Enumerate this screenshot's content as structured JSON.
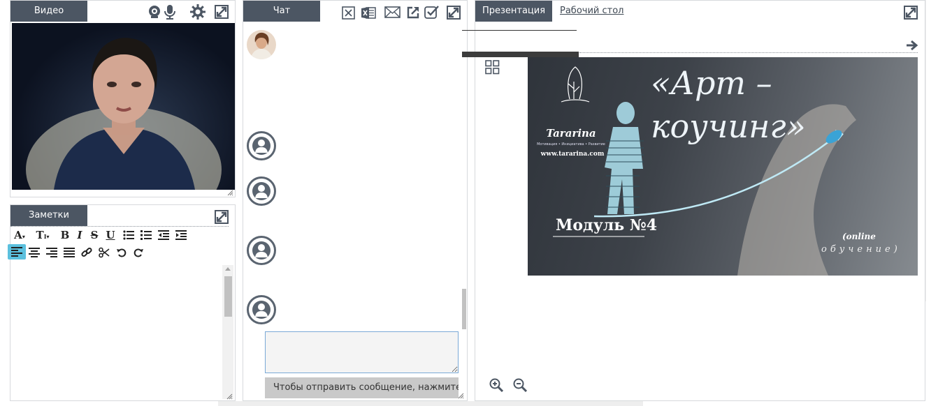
{
  "video": {
    "tab_label": "Видео",
    "icons": [
      "webcam-icon",
      "microphone-icon",
      "gear-icon",
      "expand-icon"
    ]
  },
  "notes": {
    "tab_label": "Заметки",
    "toolbar": {
      "font_size": "A",
      "font_family": "T",
      "bold": "B",
      "italic": "I",
      "strike": "S",
      "underline": "U"
    }
  },
  "chat": {
    "tab_label": "Чат",
    "send_hint": "Чтобы отправить сообщение, нажмите Enter",
    "input_value": ""
  },
  "presentation": {
    "tab_label": "Презентация",
    "desktop_link": "Рабочий стол",
    "slide": {
      "title": "«Арт – коучинг»",
      "module": "Модуль №4",
      "online": "(online",
      "learning": "обучение)",
      "logo_name": "Tararina",
      "logo_tagline": "Мотивация • Инициатива • Развитие",
      "logo_site": "www.tararina.com"
    }
  },
  "colors": {
    "tab_bg": "#4c5663",
    "accent_active": "#5bc0de",
    "input_border": "#7aa9d6"
  }
}
